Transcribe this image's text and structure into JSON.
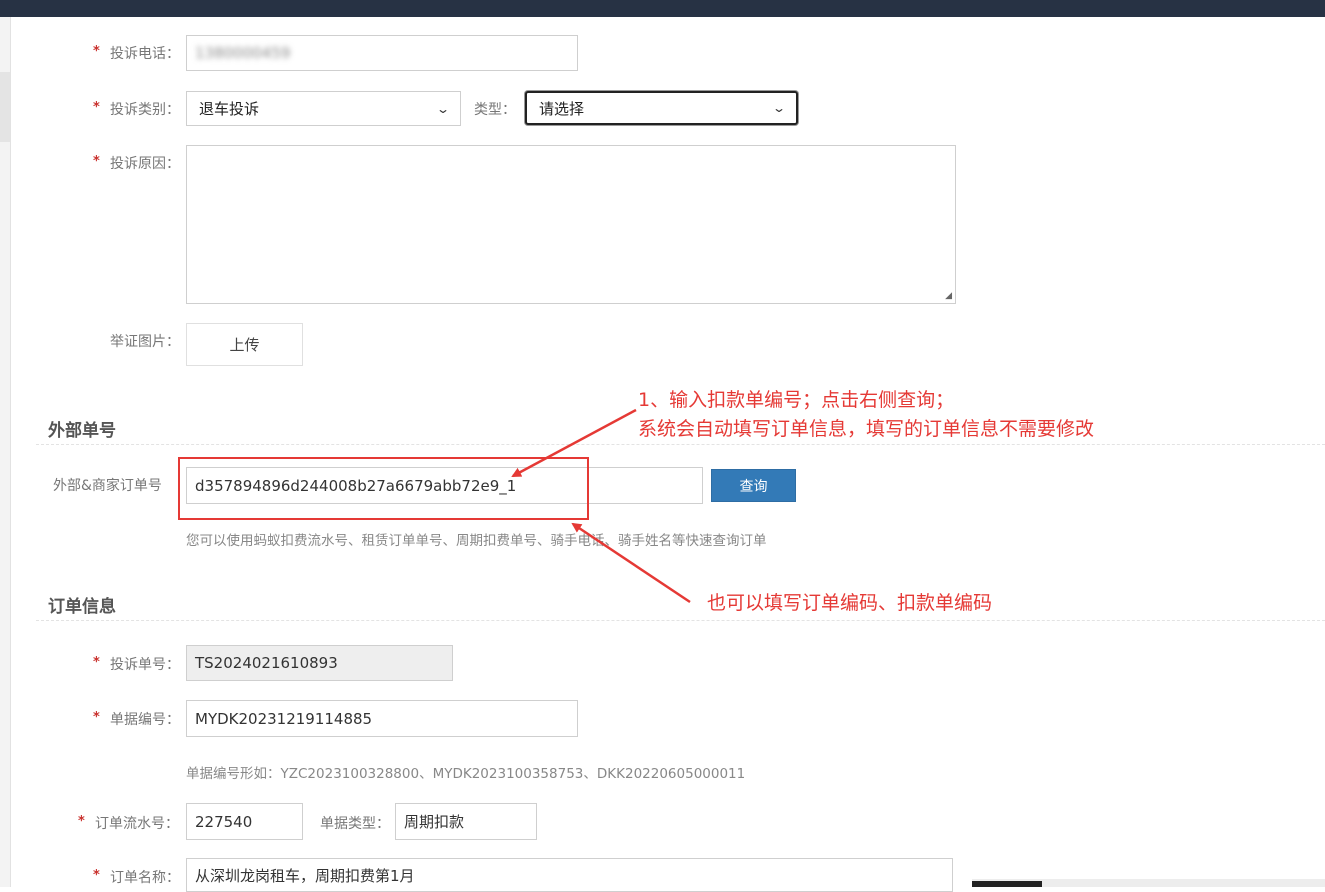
{
  "form": {
    "phone": {
      "label": "投诉电话：",
      "value": "1380000459"
    },
    "category": {
      "label": "投诉类别：",
      "selected": "退车投诉"
    },
    "type": {
      "label": "类型：",
      "selected": "请选择"
    },
    "reason": {
      "label": "投诉原因：",
      "value": ""
    },
    "evidence": {
      "label": "举证图片：",
      "button": "上传"
    }
  },
  "external": {
    "section_title": "外部单号",
    "label": "外部&商家订单号",
    "value": "d357894896d244008b27a6679abb72e9_1",
    "query_button": "查询",
    "hint": "您可以使用蚂蚁扣费流水号、租赁订单单号、周期扣费单号、骑手电话、骑手姓名等快速查询订单"
  },
  "order": {
    "section_title": "订单信息",
    "complaint_no": {
      "label": "投诉单号：",
      "value": "TS2024021610893"
    },
    "doc_no": {
      "label": "单据编号：",
      "value": "MYDK20231219114885",
      "hint": "单据编号形如：YZC2023100328800、MYDK2023100358753、DKK20220605000011"
    },
    "serial": {
      "label": "订单流水号：",
      "value": "227540"
    },
    "doc_type": {
      "label": "单据类型：",
      "value": "周期扣款"
    },
    "order_name": {
      "label": "订单名称：",
      "value": "从深圳龙岗租车，周期扣费第1月"
    }
  },
  "annotations": {
    "note1_line1": "1、输入扣款单编号；点击右侧查询；",
    "note1_line2": "系统会自动填写订单信息，填写的订单信息不需要修改",
    "note2": "也可以填写订单编码、扣款单编码"
  },
  "required_mark": "*",
  "colors": {
    "accent": "#337ab7",
    "annotation": "#e53935",
    "required": "#c9302c",
    "topbar": "#273244"
  }
}
